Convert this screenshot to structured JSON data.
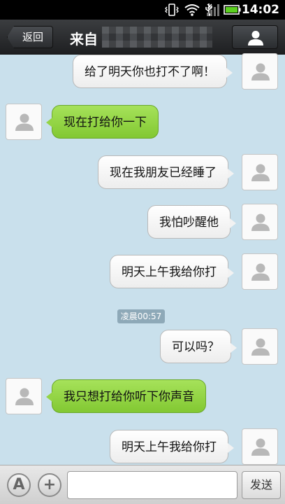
{
  "status_bar": {
    "time": "14:02",
    "icons": [
      "vibrate-icon",
      "wifi-icon",
      "usb-icon",
      "signal-icon",
      "battery-icon"
    ]
  },
  "header": {
    "back_label": "返回",
    "title_prefix": "来自",
    "profile_icon": "person-icon"
  },
  "messages": [
    {
      "side": "sent",
      "text": "给了明天你也打不了啊！"
    },
    {
      "side": "recv",
      "text": "现在打给你一下"
    },
    {
      "side": "sent",
      "text": "现在我朋友已经睡了"
    },
    {
      "side": "sent",
      "text": "我怕吵醒他"
    },
    {
      "side": "sent",
      "text": "明天上午我给你打"
    },
    {
      "side": "sent",
      "text": "可以吗？"
    },
    {
      "side": "recv",
      "text": "我只想打给你听下你声音"
    },
    {
      "side": "sent",
      "text": "明天上午我给你打"
    }
  ],
  "timestamp": "凌晨00:57",
  "input_bar": {
    "keyboard_label": "A",
    "add_label": "+",
    "input_value": "",
    "send_label": "发送"
  },
  "colors": {
    "background": "#c9e0ec",
    "received_bubble": "#94d445",
    "sent_bubble": "#f2f2f2",
    "header": "#2a2c2f"
  }
}
